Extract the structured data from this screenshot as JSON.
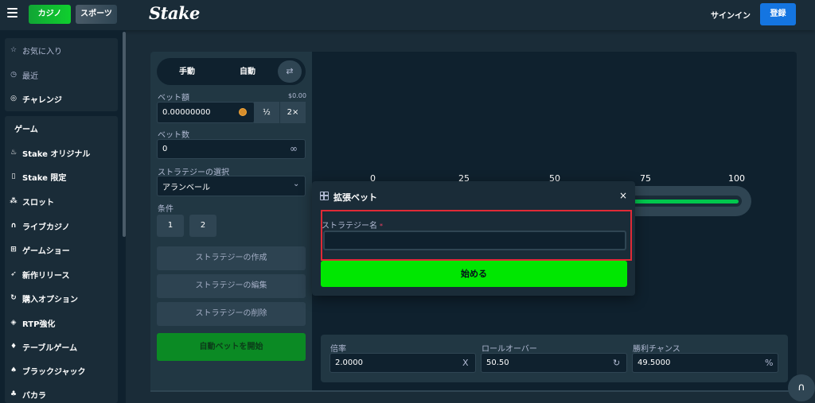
{
  "header": {
    "casino_tab": "カジノ",
    "sports_tab": "スポーツ",
    "logo": "Stake",
    "signin": "サインイン",
    "register": "登録"
  },
  "sidebar": {
    "top_items": [
      {
        "label": "お気に入り",
        "icon": "star-icon"
      },
      {
        "label": "最近",
        "icon": "history-icon"
      },
      {
        "label": "チャレンジ",
        "icon": "target-icon"
      }
    ],
    "section_title": "ゲーム",
    "game_items": [
      {
        "label": "Stake オリジナル",
        "icon": "flame-icon"
      },
      {
        "label": "Stake 限定",
        "icon": "bookmark-icon"
      },
      {
        "label": "スロット",
        "icon": "slots-icon"
      },
      {
        "label": "ライブカジノ",
        "icon": "headset-icon"
      },
      {
        "label": "ゲームショー",
        "icon": "gift-icon"
      },
      {
        "label": "新作リリース",
        "icon": "rocket-icon"
      },
      {
        "label": "購入オプション",
        "icon": "refresh-icon"
      },
      {
        "label": "RTP強化",
        "icon": "rtp-icon"
      },
      {
        "label": "テーブルゲーム",
        "icon": "drop-icon"
      },
      {
        "label": "ブラックジャック",
        "icon": "spade-icon"
      },
      {
        "label": "バカラ",
        "icon": "cards-icon"
      }
    ]
  },
  "controls": {
    "manual": "手動",
    "auto": "自動",
    "bet_amount_label": "ベット額",
    "bet_amount_value_usd": "$0.00",
    "bet_amount": "0.00000000",
    "half": "½",
    "double": "2×",
    "bet_count_label": "ベット数",
    "bet_count": "0",
    "strategy_label": "ストラテジーの選択",
    "strategy_value": "アランベール",
    "condition_label": "条件",
    "condition_1": "1",
    "condition_2": "2",
    "create_strategy": "ストラテジーの作成",
    "edit_strategy": "ストラテジーの編集",
    "delete_strategy": "ストラテジーの削除",
    "start_autobet": "自動ベットを開始"
  },
  "slider": {
    "ticks": [
      "0",
      "25",
      "50",
      "75",
      "100"
    ],
    "roll_over": 50.5
  },
  "stats": {
    "multiplier_label": "倍率",
    "multiplier": "2.0000",
    "multiplier_icon": "X",
    "rollover_label": "ロールオーバー",
    "rollover": "50.50",
    "win_chance_label": "勝利チャンス",
    "win_chance": "49.5000",
    "win_chance_icon": "%"
  },
  "modal": {
    "title": "拡張ベット",
    "close": "×",
    "field_label": "ストラテジー名",
    "required_mark": "*",
    "field_value": "",
    "start": "始める"
  }
}
